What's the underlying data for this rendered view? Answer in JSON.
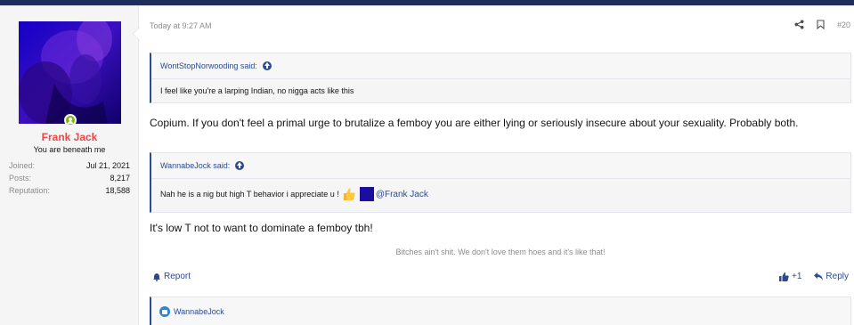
{
  "user": {
    "name": "Frank Jack",
    "title": "You are beneath me",
    "stats": [
      {
        "label": "Joined:",
        "value": "Jul 21, 2021"
      },
      {
        "label": "Posts:",
        "value": "8,217"
      },
      {
        "label": "Reputation:",
        "value": "18,588"
      }
    ]
  },
  "post": {
    "time": "Today at 9:27 AM",
    "number": "#20",
    "quote1": {
      "author": "WontStopNorwooding said:",
      "text": "I feel like you're a larping Indian, no nigga acts like this"
    },
    "message1": "Copium. If you don't feel a primal urge to brutalize a femboy you are either lying or seriously insecure about your sexuality. Probably both.",
    "quote2": {
      "author": "WannabeJock said:",
      "text": "Nah he is a nig but high T behavior i appreciate u !",
      "mention": "@Frank Jack"
    },
    "message2": "It's low T not to want to dominate a femboy tbh!",
    "signature": "Bitches ain't shit. We don't love them hoes and it's like that!"
  },
  "actions": {
    "report": "Report",
    "like_count": "+1",
    "reply": "Reply"
  },
  "reactions": {
    "users": "WannabeJock"
  },
  "colors": {
    "accent": "#2b4a91",
    "username": "#f04848",
    "topbar": "#1d2d5c"
  }
}
